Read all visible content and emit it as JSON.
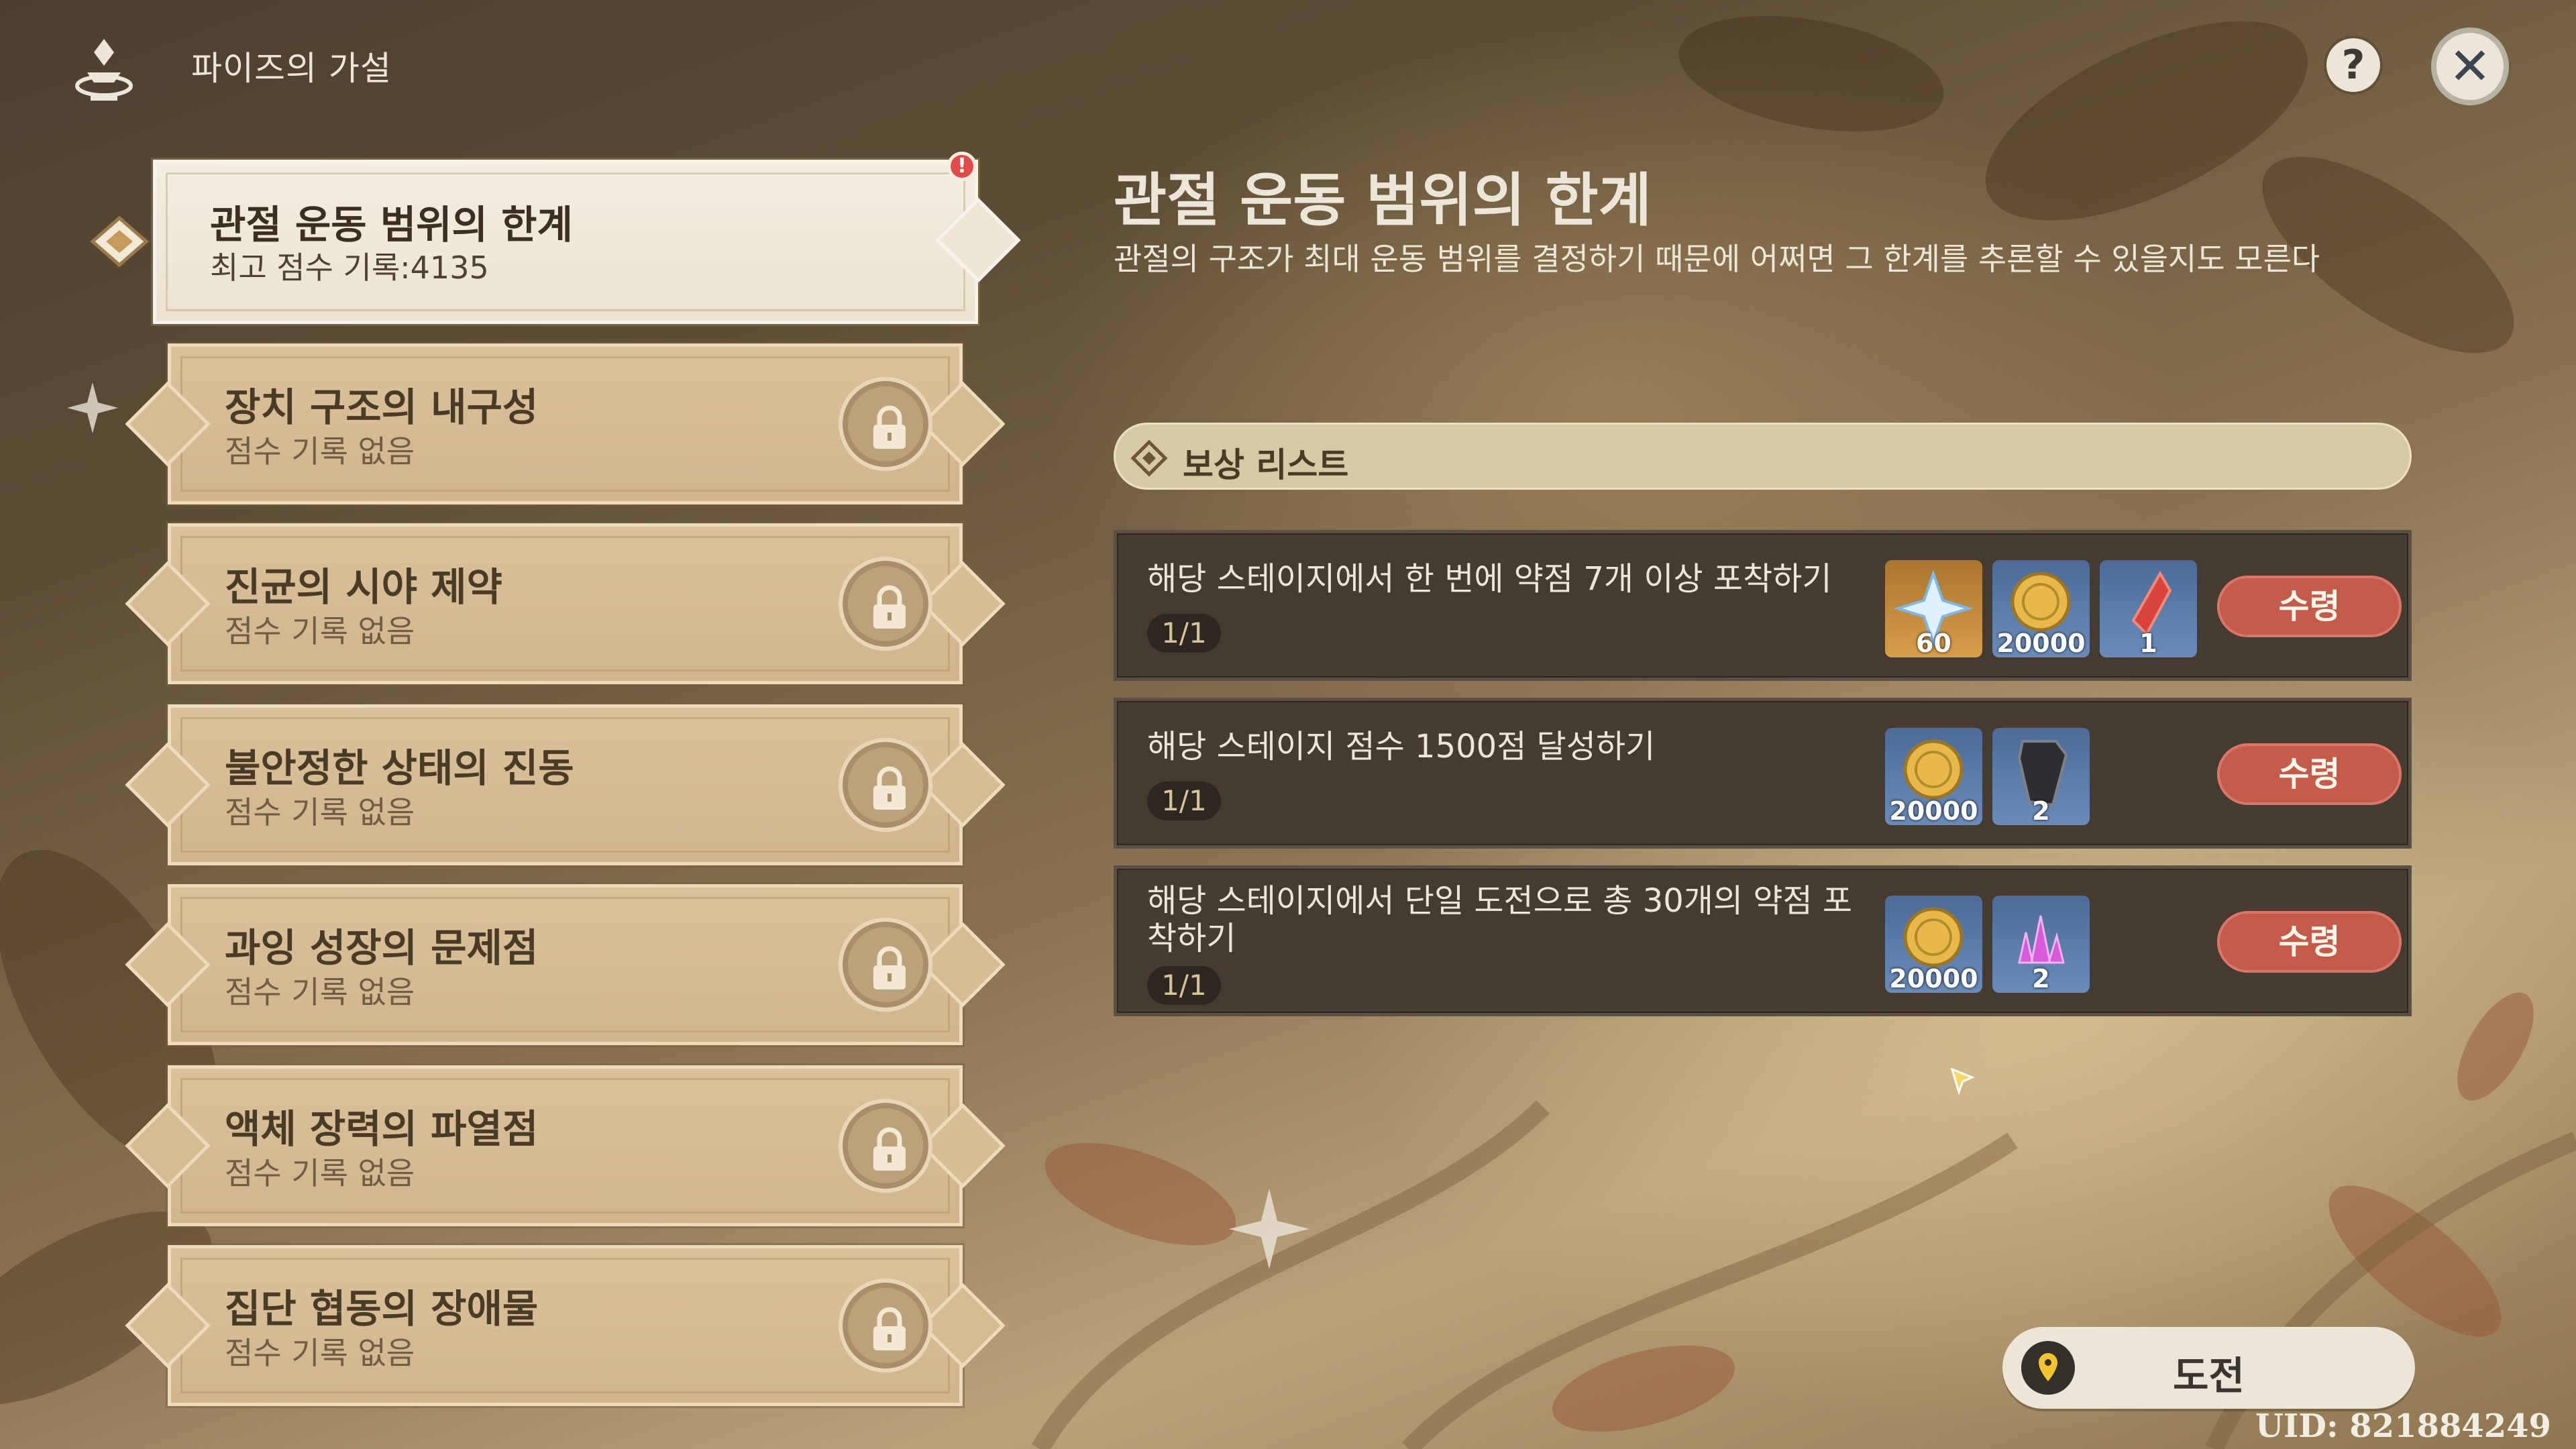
{
  "header": {
    "title": "파이즈의 가설",
    "help_label": "?",
    "close_label": "✕"
  },
  "stages": [
    {
      "title": "관절 운동 범위의 한계",
      "subtitle": "최고 점수 기록:4135",
      "locked": false,
      "active": true,
      "badge": "!"
    },
    {
      "title": "장치 구조의 내구성",
      "subtitle": "점수 기록 없음",
      "locked": true
    },
    {
      "title": "진균의 시야 제약",
      "subtitle": "점수 기록 없음",
      "locked": true
    },
    {
      "title": "불안정한 상태의 진동",
      "subtitle": "점수 기록 없음",
      "locked": true
    },
    {
      "title": "과잉 성장의 문제점",
      "subtitle": "점수 기록 없음",
      "locked": true
    },
    {
      "title": "액체 장력의 파열점",
      "subtitle": "점수 기록 없음",
      "locked": true
    },
    {
      "title": "집단 협동의 장애물",
      "subtitle": "점수 기록 없음",
      "locked": true
    }
  ],
  "detail": {
    "title": "관절 운동 범위의 한계",
    "description": "관절의 구조가 최대 운동 범위를 결정하기 때문에 어쩌면 그 한계를 추론할 수 있을지도 모른다"
  },
  "rewards": {
    "header_label": "보상 리스트",
    "tasks": [
      {
        "description": "해당 스테이지에서 한 번에 약점 7개 이상 포착하기",
        "progress": "1/1",
        "items": [
          {
            "icon": "primogem-icon",
            "count": "60"
          },
          {
            "icon": "mora-icon",
            "count": "20000"
          },
          {
            "icon": "red-crystal-icon",
            "count": "1"
          }
        ],
        "claim_label": "수령"
      },
      {
        "description": "해당 스테이지 점수 1500점 달성하기",
        "progress": "1/1",
        "items": [
          {
            "icon": "mora-icon",
            "count": "20000"
          },
          {
            "icon": "dark-material-icon",
            "count": "2"
          }
        ],
        "claim_label": "수령"
      },
      {
        "description": "해당 스테이지에서 단일 도전으로 총 30개의 약점 포착하기",
        "progress": "1/1",
        "items": [
          {
            "icon": "mora-icon",
            "count": "20000"
          },
          {
            "icon": "purple-crystal-icon",
            "count": "2"
          }
        ],
        "claim_label": "수령"
      }
    ]
  },
  "challenge_button": {
    "label": "도전"
  },
  "uid": "UID: 821884249",
  "colors": {
    "claim_button": "#c55a4b",
    "task_background": "#453b30",
    "card_locked": "#d9c19a",
    "card_active": "#f4eee2",
    "text_light": "#ece5d8"
  }
}
